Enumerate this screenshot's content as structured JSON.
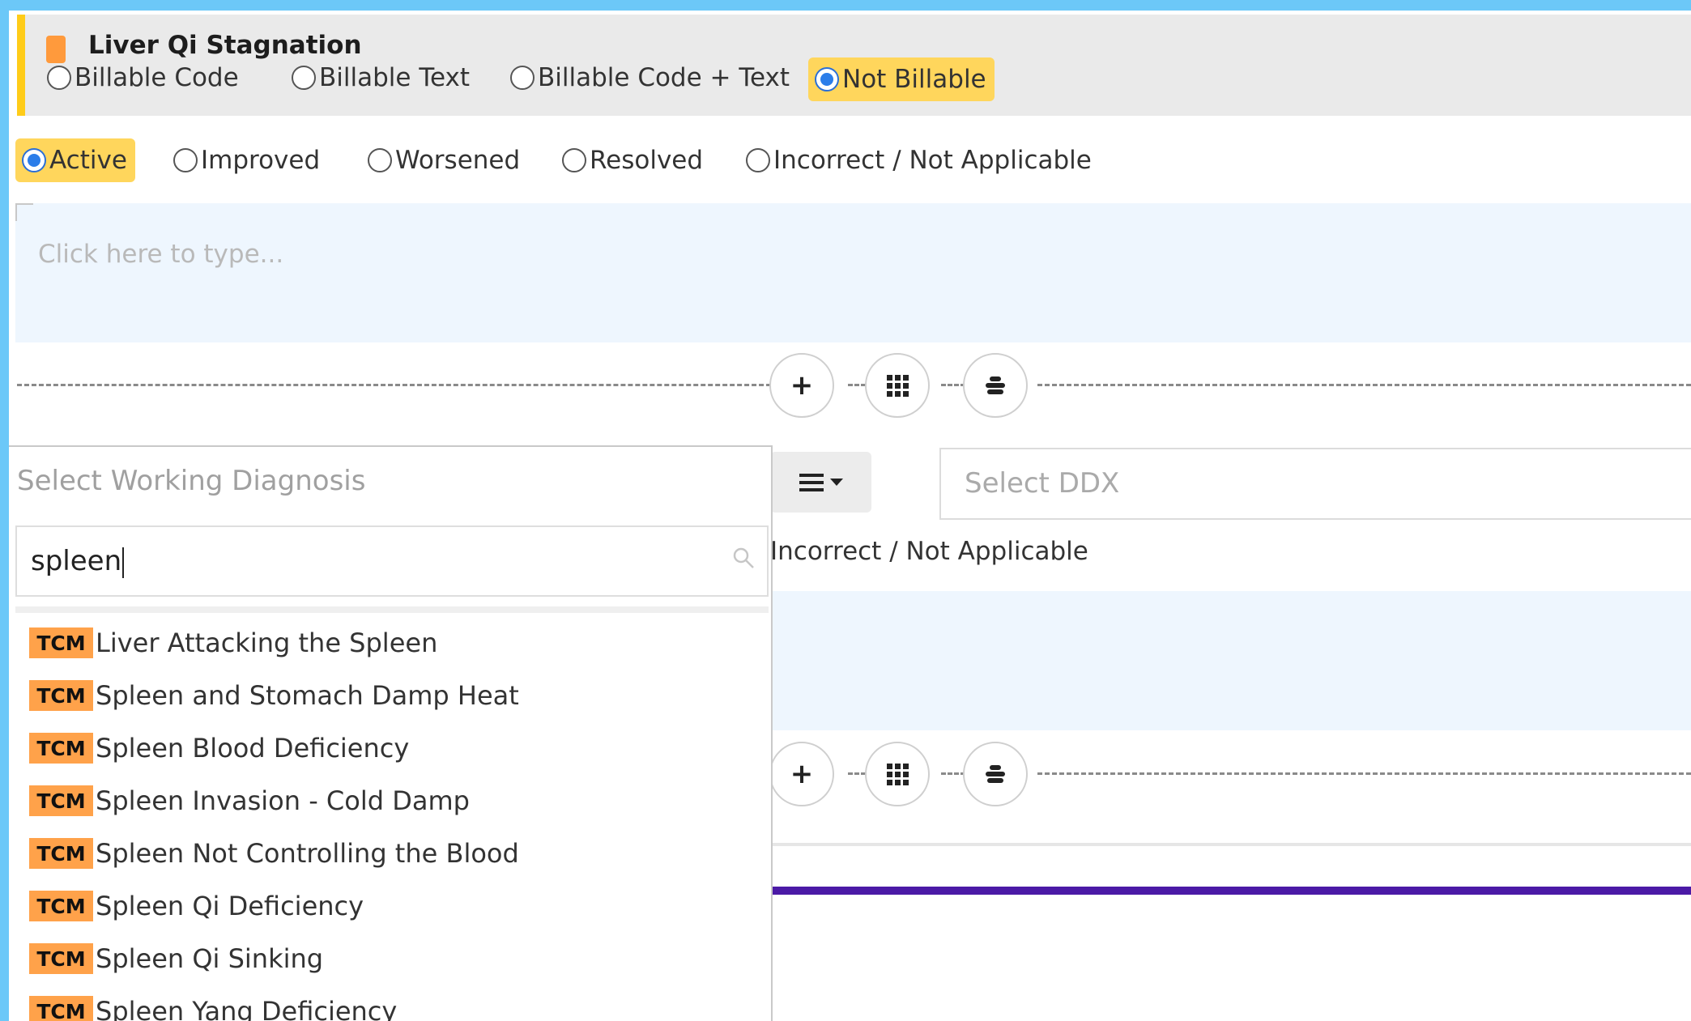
{
  "diagnosis": {
    "title": "Liver Qi Stagnation",
    "billing_options": [
      "Billable Code",
      "Billable Text",
      "Billable Code + Text",
      "Not Billable"
    ],
    "billing_selected": "Not Billable",
    "status_options": [
      "Active",
      "Improved",
      "Worsened",
      "Resolved",
      "Incorrect / Not Applicable"
    ],
    "status_selected": "Active",
    "notes_placeholder": "Click here to type..."
  },
  "toolbar": {
    "add_label": "+"
  },
  "second_block": {
    "ddx_placeholder": "Select DDX",
    "status_partial": "Incorrect / Not Applicable"
  },
  "dropdown": {
    "placeholder": "Select Working Diagnosis",
    "search_value": "spleen",
    "badge_label": "TCM",
    "results": [
      "Liver Attacking the Spleen",
      "Spleen and Stomach Damp Heat",
      "Spleen Blood Deficiency",
      "Spleen Invasion - Cold Damp",
      "Spleen Not Controlling the Blood",
      "Spleen Qi Deficiency",
      "Spleen Qi Sinking",
      "Spleen Yang Deficiency"
    ]
  },
  "colors": {
    "background": "#6cc8f8",
    "highlight": "#ffd65c",
    "header_accent": "#ffcc19",
    "badge": "#ffa24a",
    "purple_divider": "#4b1aa6"
  }
}
